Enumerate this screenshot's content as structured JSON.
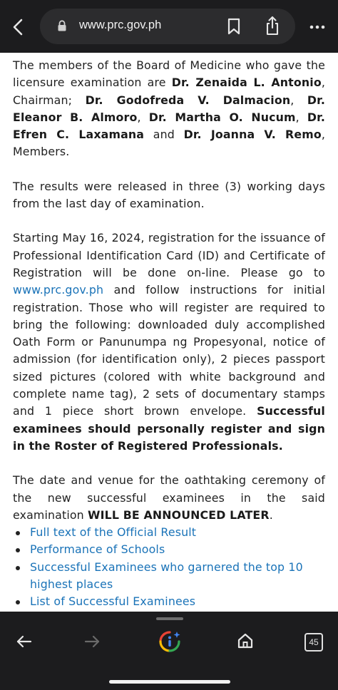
{
  "browser": {
    "url": "www.prc.gov.ph",
    "tab_count": "45"
  },
  "content": {
    "p1": {
      "t1": "The members of the Board of Medicine who gave the licensure examination are ",
      "b1": "Dr. Zenaida L. Antonio",
      "t2": ", Chairman; ",
      "b2": "Dr. Godofreda V. Dalmacion",
      "t3": ", ",
      "b3": "Dr. Eleanor B. Almoro",
      "t4": ", ",
      "b4": "Dr. Martha O. Nucum",
      "t5": ", ",
      "b5": "Dr. Efren C. Laxamana",
      "t6": " and ",
      "b6": "Dr. Joanna V. Remo",
      "t7": ", Members."
    },
    "p2": "The results were released in three (3) working days from the last day of examination.",
    "p3": {
      "t1": "Starting May 16, 2024, registration for the issuance of Professional Identification Card (ID) and Certificate of Registration will be done on-line.  Please go to ",
      "link": "www.prc.gov.ph",
      "t2": " and follow instructions for initial registration.  Those who will register are required to bring the following: downloaded duly accomplished Oath Form or Panunumpa ng Propesyonal, notice of admission (for identification only), 2 pieces passport sized pictures (colored with white background and complete name tag), 2 sets of documentary stamps and 1 piece short brown envelope.  ",
      "bold": "Successful examinees should personally register and sign in the Roster of Registered Professionals."
    },
    "p4": {
      "t1": "The date and venue for the oathtaking ceremony of the new successful examinees in the said examination ",
      "bold": "WILL BE ANNOUNCED LATER",
      "t2": "."
    },
    "links": [
      "Full text of the Official Result",
      "Performance of Schools",
      "Successful Examinees who garnered the top 10 highest places",
      "List of Successful Examinees"
    ]
  }
}
